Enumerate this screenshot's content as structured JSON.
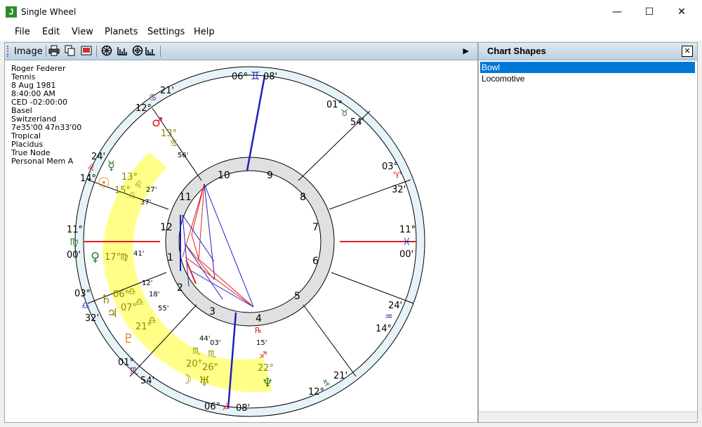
{
  "window": {
    "title": "Single Wheel",
    "icon_letter": "J"
  },
  "window_controls": {
    "minimize": "—",
    "maximize": "☐",
    "close": "✕"
  },
  "menu": [
    "File",
    "Edit",
    "View",
    "Planets",
    "Settings",
    "Help"
  ],
  "toolbar": {
    "label": "Image",
    "more_arrow": "▶"
  },
  "chart_info": [
    "Roger Federer",
    "Tennis",
    "8 Aug 1981",
    "8:40:00 AM",
    "CED -02:00:00",
    "Basel",
    "Switzerland",
    "7e35'00 47n33'00",
    "Tropical",
    "Placidus",
    "True Node",
    "Personal Mem A"
  ],
  "house_numbers": [
    "1",
    "2",
    "3",
    "4",
    "5",
    "6",
    "7",
    "8",
    "9",
    "10",
    "11",
    "12"
  ],
  "cusp_labels": [
    {
      "deg": "06°",
      "sign": "♊",
      "min": "08'"
    },
    {
      "deg": "01°",
      "sign": "♉",
      "min": "54'"
    },
    {
      "deg": "03°",
      "sign": "♈",
      "min": "32'"
    },
    {
      "deg": "11°",
      "sign": "♓",
      "min": "00'"
    },
    {
      "deg": "24'",
      "sign": "♒",
      "min": "14°"
    },
    {
      "deg": "21'",
      "sign": "♑",
      "min": "12°"
    },
    {
      "deg": "06°",
      "sign": "♐",
      "min": "08'"
    },
    {
      "deg": "01°",
      "sign": "♏",
      "min": "54'"
    },
    {
      "deg": "03°",
      "sign": "♎",
      "min": "32'"
    },
    {
      "deg": "11°",
      "sign": "♍",
      "min": "00'"
    },
    {
      "deg": "24'",
      "sign": "♌",
      "min": "14°"
    },
    {
      "deg": "21'",
      "sign": "♋",
      "min": "12°"
    }
  ],
  "planets": [
    {
      "glyph": "♂",
      "deg": "13°",
      "sign": "♋",
      "min": "56'"
    },
    {
      "glyph": "☿",
      "deg": "13°",
      "sign": "♌",
      "min": "27'"
    },
    {
      "glyph": "☉",
      "deg": "15°",
      "sign": "♌",
      "min": "37'"
    },
    {
      "glyph": "♀",
      "deg": "17°",
      "sign": "♍",
      "min": "41'"
    },
    {
      "glyph": "♄",
      "deg": "06°",
      "sign": "♎",
      "min": "12'"
    },
    {
      "glyph": "♃",
      "deg": "07°",
      "sign": "♎",
      "min": "18'"
    },
    {
      "glyph": "♇",
      "deg": "21°",
      "sign": "♎",
      "min": "55'"
    },
    {
      "glyph": "☽",
      "deg": "20°",
      "sign": "♏",
      "min": "44'"
    },
    {
      "glyph": "♅",
      "deg": "26°",
      "sign": "♏",
      "min": "03'"
    },
    {
      "glyph": "♆",
      "deg": "22°",
      "sign": "♐",
      "min": "15'",
      "retro": "℞"
    }
  ],
  "chart_shapes": {
    "title": "Chart Shapes",
    "close": "✕",
    "items": [
      "Bowl",
      "Locomotive"
    ],
    "selected": "Bowl"
  },
  "colors": {
    "accent": "#0078d7",
    "highlight_band": "#ffff88",
    "axis_red": "#e02020",
    "mc_blue": "#2020c0",
    "ring_bg": "#e6f4fa"
  }
}
